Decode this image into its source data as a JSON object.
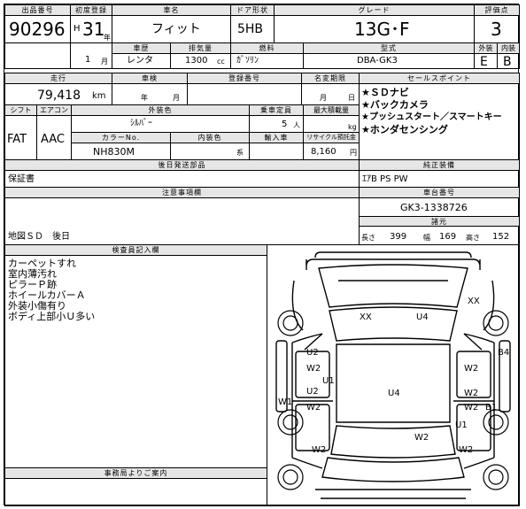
{
  "header": {
    "lot_label": "出品番号",
    "lot_number": "90296",
    "first_reg_label": "初度登録",
    "era": "H",
    "year": "31",
    "year_unit": "年",
    "month": "1",
    "month_unit": "月",
    "car_name_label": "車名",
    "car_name": "フィット",
    "car_type_label": "車歴",
    "car_type": "レンタ",
    "doors_label": "ドア形状",
    "doors": "5HB",
    "displacement_label": "排気量",
    "displacement": "1300",
    "displacement_unit": "cc",
    "fuel_label": "燃料",
    "fuel": "ｶﾞｿﾘﾝ",
    "grade_label": "グレード",
    "grade": "13G･F",
    "model_label": "型式",
    "model": "DBA-GK3",
    "score_label": "評価点",
    "score": "3",
    "ext_label": "外装",
    "int_label": "内装",
    "ext_grade": "E",
    "int_grade": "B"
  },
  "details": {
    "mileage_label": "走行",
    "mileage": "79,418",
    "mileage_unit": "km",
    "inspection_label": "車検",
    "inspection_year_unit": "年",
    "inspection_month_unit": "月",
    "reg_number_label": "登録番号",
    "name_change_label": "名変期限",
    "name_change_month": "月",
    "name_change_day": "日",
    "shift_label": "シフト",
    "shift": "FAT",
    "aircon_label": "エアコン",
    "aircon": "AAC",
    "color_label": "外装色",
    "color": "ｼﾙﾊﾞｰ",
    "capacity_label": "乗車定員",
    "capacity": "5",
    "capacity_unit": "人",
    "max_load_label": "最大積載量",
    "max_load_unit": "kg",
    "color_no_label": "カラーNo.",
    "color_no": "NH830M",
    "interior_label": "内装色",
    "interior_unit": "系",
    "import_label": "輸入車",
    "recycle_label": "リサイクル預託金",
    "recycle": "8,160",
    "recycle_unit": "円",
    "later_parts_label": "後日発送部品",
    "later_parts": "保証書"
  },
  "sales_points": {
    "label": "セールスポイント",
    "items": [
      "★ＳＤナビ",
      "★バックカメラ",
      "★プッシュスタート／スマートキー",
      "★ホンダセンシング"
    ]
  },
  "equipment": {
    "label": "純正装備",
    "value": "ｴｱB  PS  PW"
  },
  "caution": {
    "label": "注意事項欄",
    "value": "地図ＳＤ　後日"
  },
  "chassis": {
    "label": "車台番号",
    "value": "GK3-1338726",
    "dims_label": "諸元",
    "length_label": "長さ",
    "length": "399",
    "width_label": "幅",
    "width": "169",
    "height_label": "高さ",
    "height": "152"
  },
  "inspector": {
    "label": "検査員記入欄",
    "lines": [
      "カーペットすれ",
      "室内薄汚れ",
      "ピラーＰ跡",
      "ホイールカバーＡ",
      "外装小傷有り",
      "ボディ上部小Ｕ多い"
    ]
  },
  "office": {
    "label": "事務局よりご案内"
  },
  "damage_marks": [
    "XX",
    "U4",
    "XX",
    "U2",
    "W2",
    "U1",
    "W2",
    "B4",
    "U2",
    "W2",
    "U4",
    "W2",
    "W1",
    "W2",
    "B1",
    "U1",
    "W2",
    "W2",
    "W2"
  ]
}
